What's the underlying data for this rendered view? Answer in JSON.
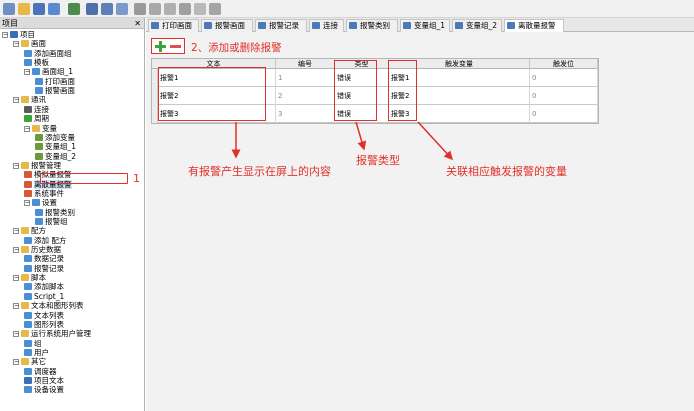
{
  "tree": {
    "header": "项目",
    "close": "✕",
    "items": [
      {
        "label": "项目",
        "level": 0,
        "exp": "−",
        "icon": "project-icon",
        "color": "#3a6fb5"
      },
      {
        "label": "画面",
        "level": 1,
        "exp": "−",
        "icon": "folder-icon",
        "color": "#e8b84a"
      },
      {
        "label": "添加画面组",
        "level": 2,
        "exp": "",
        "icon": "add-screen-icon",
        "color": "#4a8fd6"
      },
      {
        "label": "模板",
        "level": 2,
        "exp": "",
        "icon": "template-icon",
        "color": "#4a8fd6"
      },
      {
        "label": "画面组_1",
        "level": 2,
        "exp": "−",
        "icon": "screen-group-icon",
        "color": "#4a8fd6"
      },
      {
        "label": "打印画面",
        "level": 3,
        "exp": "",
        "icon": "screen-icon",
        "color": "#4a8fd6"
      },
      {
        "label": "报警画面",
        "level": 3,
        "exp": "",
        "icon": "screen-icon",
        "color": "#4a8fd6"
      },
      {
        "label": "通讯",
        "level": 1,
        "exp": "−",
        "icon": "folder-icon",
        "color": "#e8b84a"
      },
      {
        "label": "连接",
        "level": 2,
        "exp": "",
        "icon": "connection-icon",
        "color": "#5a5a5a"
      },
      {
        "label": "周期",
        "level": 2,
        "exp": "",
        "icon": "cycle-icon",
        "color": "#3aa33a"
      },
      {
        "label": "变量",
        "level": 2,
        "exp": "−",
        "icon": "tag-icon",
        "color": "#e8b84a"
      },
      {
        "label": "添加变量",
        "level": 3,
        "exp": "",
        "icon": "add-tag-icon",
        "color": "#6a9a3a"
      },
      {
        "label": "变量组_1",
        "level": 3,
        "exp": "",
        "icon": "tag-group-icon",
        "color": "#6a9a3a"
      },
      {
        "label": "变量组_2",
        "level": 3,
        "exp": "",
        "icon": "tag-group-icon",
        "color": "#6a9a3a"
      },
      {
        "label": "报警管理",
        "level": 1,
        "exp": "−",
        "icon": "folder-icon",
        "color": "#e8b84a"
      },
      {
        "label": "模拟量报警",
        "level": 2,
        "exp": "",
        "icon": "analog-alarm-icon",
        "color": "#d45a3a"
      },
      {
        "label": "离散量报警",
        "level": 2,
        "exp": "",
        "icon": "discrete-alarm-icon",
        "color": "#d45a3a",
        "selected": true
      },
      {
        "label": "系统事件",
        "level": 2,
        "exp": "",
        "icon": "system-event-icon",
        "color": "#d45a3a"
      },
      {
        "label": "设置",
        "level": 2,
        "exp": "−",
        "icon": "settings-icon",
        "color": "#4a8fd6"
      },
      {
        "label": "报警类别",
        "level": 3,
        "exp": "",
        "icon": "alarm-class-icon",
        "color": "#4a8fd6"
      },
      {
        "label": "报警组",
        "level": 3,
        "exp": "",
        "icon": "alarm-group-icon",
        "color": "#4a8fd6"
      },
      {
        "label": "配方",
        "level": 1,
        "exp": "−",
        "icon": "folder-icon",
        "color": "#e8b84a"
      },
      {
        "label": "添加 配方",
        "level": 2,
        "exp": "",
        "icon": "add-recipe-icon",
        "color": "#4a8fd6"
      },
      {
        "label": "历史数据",
        "level": 1,
        "exp": "−",
        "icon": "folder-icon",
        "color": "#e8b84a"
      },
      {
        "label": "数据记录",
        "level": 2,
        "exp": "",
        "icon": "data-log-icon",
        "color": "#4a8fd6"
      },
      {
        "label": "报警记录",
        "level": 2,
        "exp": "",
        "icon": "alarm-log-icon",
        "color": "#4a8fd6"
      },
      {
        "label": "脚本",
        "level": 1,
        "exp": "−",
        "icon": "folder-icon",
        "color": "#e8b84a"
      },
      {
        "label": "添加脚本",
        "level": 2,
        "exp": "",
        "icon": "add-script-icon",
        "color": "#4a8fd6"
      },
      {
        "label": "Script_1",
        "level": 2,
        "exp": "",
        "icon": "script-icon",
        "color": "#4a8fd6"
      },
      {
        "label": "文本和图形列表",
        "level": 1,
        "exp": "−",
        "icon": "folder-icon",
        "color": "#e8b84a"
      },
      {
        "label": "文本列表",
        "level": 2,
        "exp": "",
        "icon": "text-list-icon",
        "color": "#4a8fd6"
      },
      {
        "label": "图形列表",
        "level": 2,
        "exp": "",
        "icon": "graphic-list-icon",
        "color": "#4a8fd6"
      },
      {
        "label": "运行系统用户管理",
        "level": 1,
        "exp": "−",
        "icon": "folder-icon",
        "color": "#e8b84a"
      },
      {
        "label": "组",
        "level": 2,
        "exp": "",
        "icon": "group-icon",
        "color": "#4a8fd6"
      },
      {
        "label": "用户",
        "level": 2,
        "exp": "",
        "icon": "user-icon",
        "color": "#4a8fd6"
      },
      {
        "label": "其它",
        "level": 1,
        "exp": "−",
        "icon": "folder-icon",
        "color": "#e8b84a"
      },
      {
        "label": "调度器",
        "level": 2,
        "exp": "",
        "icon": "scheduler-icon",
        "color": "#4a8fd6"
      },
      {
        "label": "项目文本",
        "level": 2,
        "exp": "",
        "icon": "project-text-icon",
        "color": "#3a6fb5"
      },
      {
        "label": "设备设置",
        "level": 2,
        "exp": "",
        "icon": "device-settings-icon",
        "color": "#4a8fd6"
      }
    ]
  },
  "tabs": [
    {
      "label": "打印画面",
      "icon": "screen-icon"
    },
    {
      "label": "报警画面",
      "icon": "screen-icon"
    },
    {
      "label": "报警记录",
      "icon": "alarm-log-icon"
    },
    {
      "label": "连接",
      "icon": "connection-icon"
    },
    {
      "label": "报警类别",
      "icon": "alarm-class-icon"
    },
    {
      "label": "变量组_1",
      "icon": "tag-group-icon"
    },
    {
      "label": "变量组_2",
      "icon": "tag-group-icon"
    },
    {
      "label": "离散量报警",
      "icon": "discrete-alarm-icon",
      "active": true
    }
  ],
  "table": {
    "columns": [
      "文本",
      "编号",
      "类型",
      "触发变量",
      "触发位"
    ],
    "rows": [
      {
        "text": "报警1",
        "id": "1",
        "type": "错误",
        "trigger": "报警1",
        "bit": "0"
      },
      {
        "text": "报警2",
        "id": "2",
        "type": "错误",
        "trigger": "报警2",
        "bit": "0"
      },
      {
        "text": "报警3",
        "id": "3",
        "type": "错误",
        "trigger": "报警3",
        "bit": "0"
      }
    ]
  },
  "annotations": {
    "num1": "1",
    "add_delete": "2、添加或删除报警",
    "text_note": "有报警产生显示在屏上的内容",
    "type_note": "报警类型",
    "trigger_note": "关联相应触发报警的变量"
  },
  "colors": {
    "annotation_red": "#e0302a",
    "selection": "#cce4f7"
  }
}
